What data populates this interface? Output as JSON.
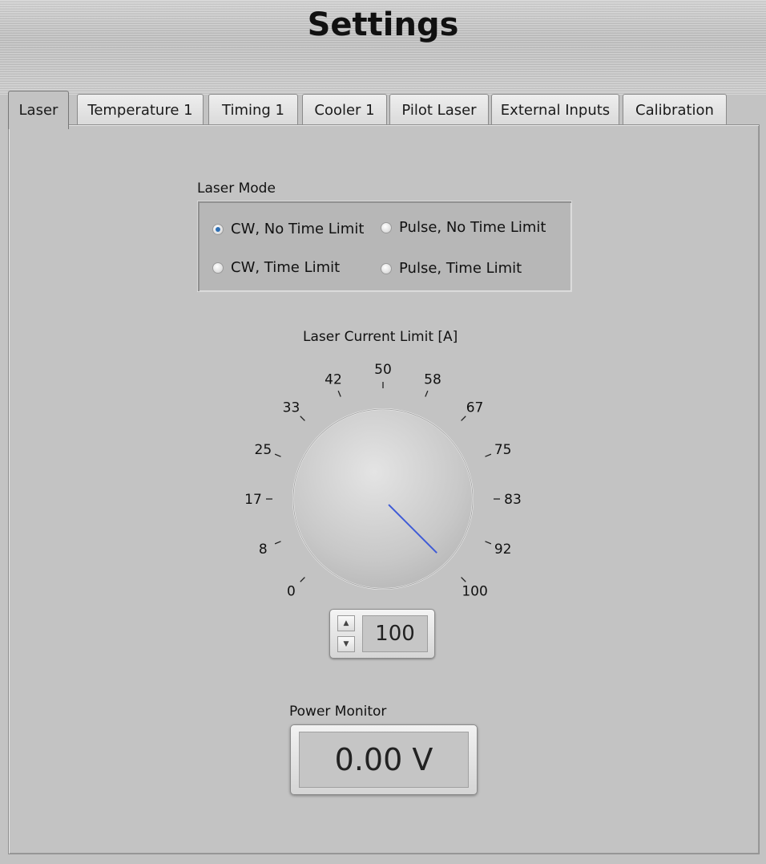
{
  "page": {
    "title": "Settings"
  },
  "tabs": [
    {
      "label": "Laser",
      "active": true
    },
    {
      "label": "Temperature 1",
      "active": false
    },
    {
      "label": "Timing 1",
      "active": false
    },
    {
      "label": "Cooler 1",
      "active": false
    },
    {
      "label": "Pilot Laser",
      "active": false
    },
    {
      "label": "External Inputs",
      "active": false
    },
    {
      "label": "Calibration",
      "active": false
    }
  ],
  "laser_mode": {
    "label": "Laser Mode",
    "options": [
      {
        "label": "CW, No Time Limit",
        "checked": true
      },
      {
        "label": "Pulse, No Time Limit",
        "checked": false
      },
      {
        "label": "CW, Time Limit",
        "checked": false
      },
      {
        "label": "Pulse, Time Limit",
        "checked": false
      }
    ]
  },
  "current_limit": {
    "label": "Laser Current Limit [A]",
    "min": 0,
    "max": 100,
    "value": 100,
    "display_value": "100",
    "ticks": [
      "0",
      "8",
      "17",
      "25",
      "33",
      "42",
      "50",
      "58",
      "67",
      "75",
      "83",
      "92",
      "100"
    ],
    "needle_color": "#3f5bd6"
  },
  "power_monitor": {
    "label": "Power Monitor",
    "value": "0.00 V"
  },
  "colors": {
    "background": "#c3c3c3",
    "radio_checked": "#2e6fb4"
  }
}
